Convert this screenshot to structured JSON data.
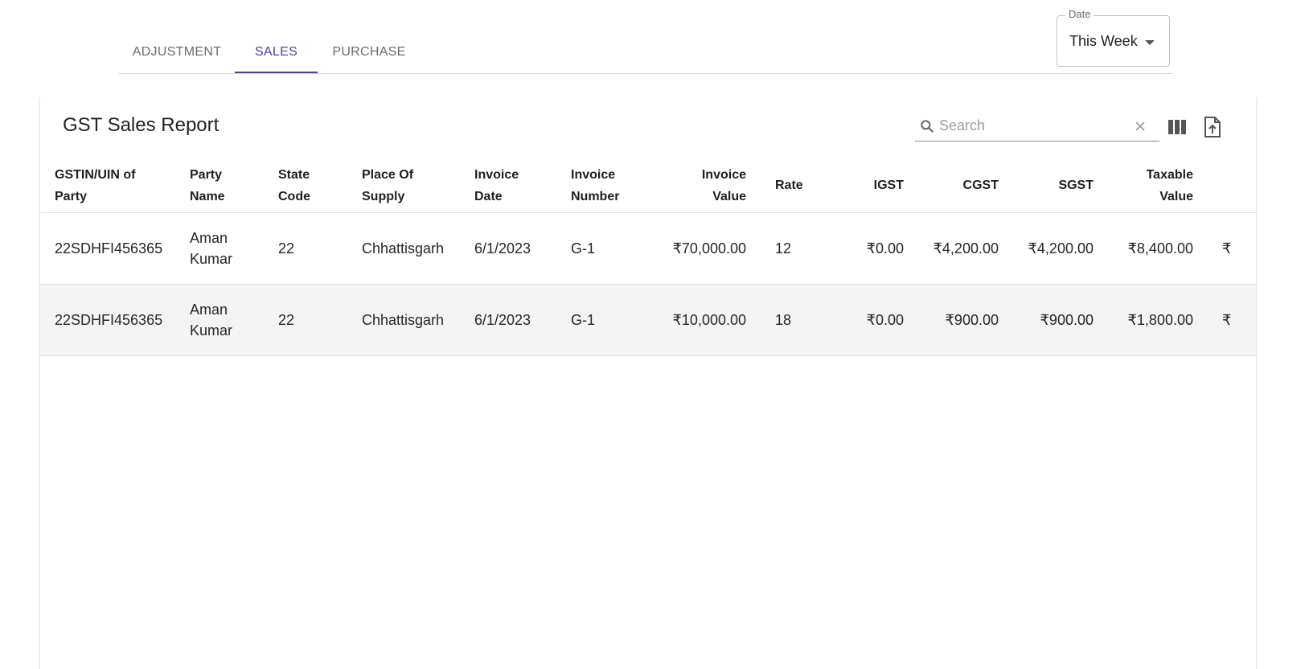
{
  "tabs": [
    {
      "label": "ADJUSTMENT",
      "active": false
    },
    {
      "label": "SALES",
      "active": true
    },
    {
      "label": "PURCHASE",
      "active": false
    }
  ],
  "date_filter": {
    "label": "Date",
    "value": "This Week"
  },
  "report": {
    "title": "GST Sales Report",
    "search_placeholder": "Search"
  },
  "table": {
    "columns": [
      {
        "l1": "GSTIN/UIN of",
        "l2": "Party"
      },
      {
        "l1": "Party",
        "l2": "Name"
      },
      {
        "l1": "State",
        "l2": "Code"
      },
      {
        "l1": "Place Of",
        "l2": "Supply"
      },
      {
        "l1": "Invoice",
        "l2": "Date"
      },
      {
        "l1": "Invoice",
        "l2": "Number"
      },
      {
        "l1": "Invoice",
        "l2": "Value"
      },
      {
        "l1": "Rate",
        "l2": ""
      },
      {
        "l1": "IGST",
        "l2": ""
      },
      {
        "l1": "CGST",
        "l2": ""
      },
      {
        "l1": "SGST",
        "l2": ""
      },
      {
        "l1": "Taxable",
        "l2": "Value"
      },
      {
        "l1": "",
        "l2": ""
      }
    ],
    "rows": [
      {
        "gstin": "22SDHFI456365",
        "party_first": "Aman",
        "party_last": "Kumar",
        "state_code": "22",
        "place": "Chhattisgarh",
        "invoice_date": "6/1/2023",
        "invoice_number": "G-1",
        "invoice_value": "₹70,000.00",
        "rate": "12",
        "igst": "₹0.00",
        "cgst": "₹4,200.00",
        "sgst": "₹4,200.00",
        "taxable_value": "₹8,400.00",
        "extra": "₹"
      },
      {
        "gstin": "22SDHFI456365",
        "party_first": "Aman",
        "party_last": "Kumar",
        "state_code": "22",
        "place": "Chhattisgarh",
        "invoice_date": "6/1/2023",
        "invoice_number": "G-1",
        "invoice_value": "₹10,000.00",
        "rate": "18",
        "igst": "₹0.00",
        "cgst": "₹900.00",
        "sgst": "₹900.00",
        "taxable_value": "₹1,800.00",
        "extra": "₹"
      }
    ]
  },
  "colors": {
    "accent": "#4a3fa6",
    "row_alt": "#f4f4f4"
  }
}
